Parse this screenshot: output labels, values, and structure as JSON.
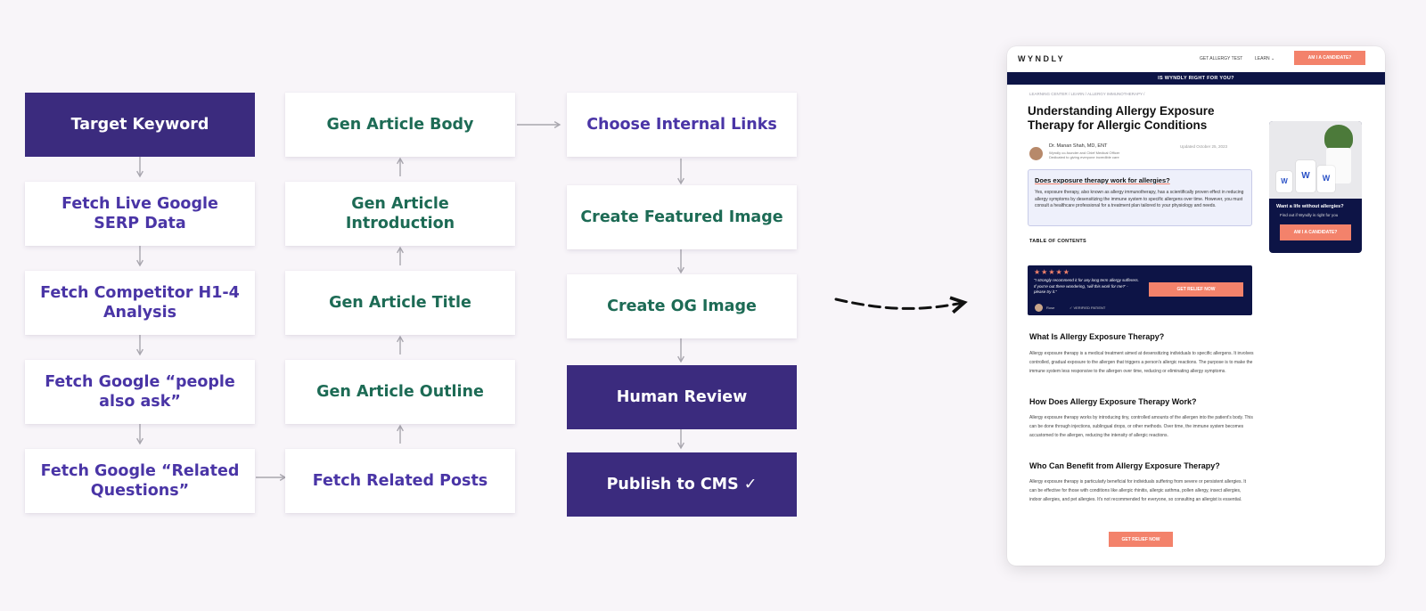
{
  "pipeline": {
    "column1": [
      {
        "label": "Target Keyword",
        "style": "dark"
      },
      {
        "label": "Fetch Live Google SERP Data",
        "style": "purple"
      },
      {
        "label": "Fetch Competitor H1-4 Analysis",
        "style": "purple"
      },
      {
        "label": "Fetch Google “people also ask”",
        "style": "purple"
      },
      {
        "label": "Fetch Google “Related Questions”",
        "style": "purple"
      }
    ],
    "column2": [
      {
        "label": "Gen Article Body",
        "style": "green"
      },
      {
        "label": "Gen Article Introduction",
        "style": "green"
      },
      {
        "label": "Gen Article Title",
        "style": "green"
      },
      {
        "label": "Gen Article Outline",
        "style": "green"
      },
      {
        "label": "Fetch Related Posts",
        "style": "purple"
      }
    ],
    "column3": [
      {
        "label": "Choose Internal Links",
        "style": "purple"
      },
      {
        "label": "Create Featured Image",
        "style": "green"
      },
      {
        "label": "Create OG Image",
        "style": "green"
      },
      {
        "label": "Human Review",
        "style": "dark"
      },
      {
        "label": "Publish to CMS ✓",
        "style": "dark"
      }
    ]
  },
  "colors": {
    "dark_node": "#3b2b7e",
    "purple_text": "#4a35a6",
    "green_text": "#1d6b55",
    "accent": "#f3826b",
    "navy": "#0d1446"
  },
  "article": {
    "logo": "WYNDLY",
    "nav": {
      "link1": "GET ALLERGY TEST",
      "link2": "LEARN ⌄",
      "cta": "AM I A CANDIDATE?"
    },
    "banner": "IS WYNDLY RIGHT FOR YOU?",
    "breadcrumb": "LEARNING CENTER  /  LEARN  /  ALLERGY IMMUNOTHERAPY  /",
    "title": "Understanding Allergy Exposure Therapy for Allergic Conditions",
    "author": {
      "name": "Dr. Manan Shah, MD, ENT",
      "role": "Wyndly co-founder and Chief Medical Officer",
      "role2": "Dedicated to giving everyone incredible care",
      "updated": "Updated October 25, 2023"
    },
    "faq": {
      "question": "Does exposure therapy work for allergies?",
      "answer": "Yes, exposure therapy, also known as allergy immunotherapy, has a scientifically proven effect in reducing allergy symptoms by desensitizing the immune system to specific allergens over time. However, you must consult a healthcare professional for a treatment plan tailored to your physiology and needs."
    },
    "side_card": {
      "heading": "Want a life without allergies?",
      "subtext": "Find out if Wyndly is right for you",
      "cta": "AM I A CANDIDATE?"
    },
    "toc": "TABLE OF CONTENTS",
    "review": {
      "stars": "★★★★★",
      "quote": "\"I strongly recommend it for any long term allergy sufferers. If you're out there wondering, 'will this work for me?' - please try it.\"",
      "cta": "GET RELIEF NOW",
      "name": "Rose",
      "verified": "✓ VERIFIED PATIENT"
    },
    "sections": [
      {
        "heading": "What Is Allergy Exposure Therapy?",
        "body": "Allergy exposure therapy is a medical treatment aimed at desensitizing individuals to specific allergens. It involves controlled, gradual exposure to the allergen that triggers a person's allergic reactions. The purpose is to make the immune system less responsive to the allergen over time, reducing or eliminating allergy symptoms."
      },
      {
        "heading": "How Does Allergy Exposure Therapy Work?",
        "body": "Allergy exposure therapy works by introducing tiny, controlled amounts of the allergen into the patient's body. This can be done through injections, sublingual drops, or other methods. Over time, the immune system becomes accustomed to the allergen, reducing the intensity of allergic reactions."
      },
      {
        "heading": "Who Can Benefit from Allergy Exposure Therapy?",
        "body": "Allergy exposure therapy is particularly beneficial for individuals suffering from severe or persistent allergies. It can be effective for those with conditions like allergic rhinitis, allergic asthma, pollen allergy, insect allergies, indoor allergies, and pet allergies. It's not recommended for everyone, so consulting an allergist is essential."
      }
    ],
    "bottom_cta": "GET RELIEF NOW"
  }
}
